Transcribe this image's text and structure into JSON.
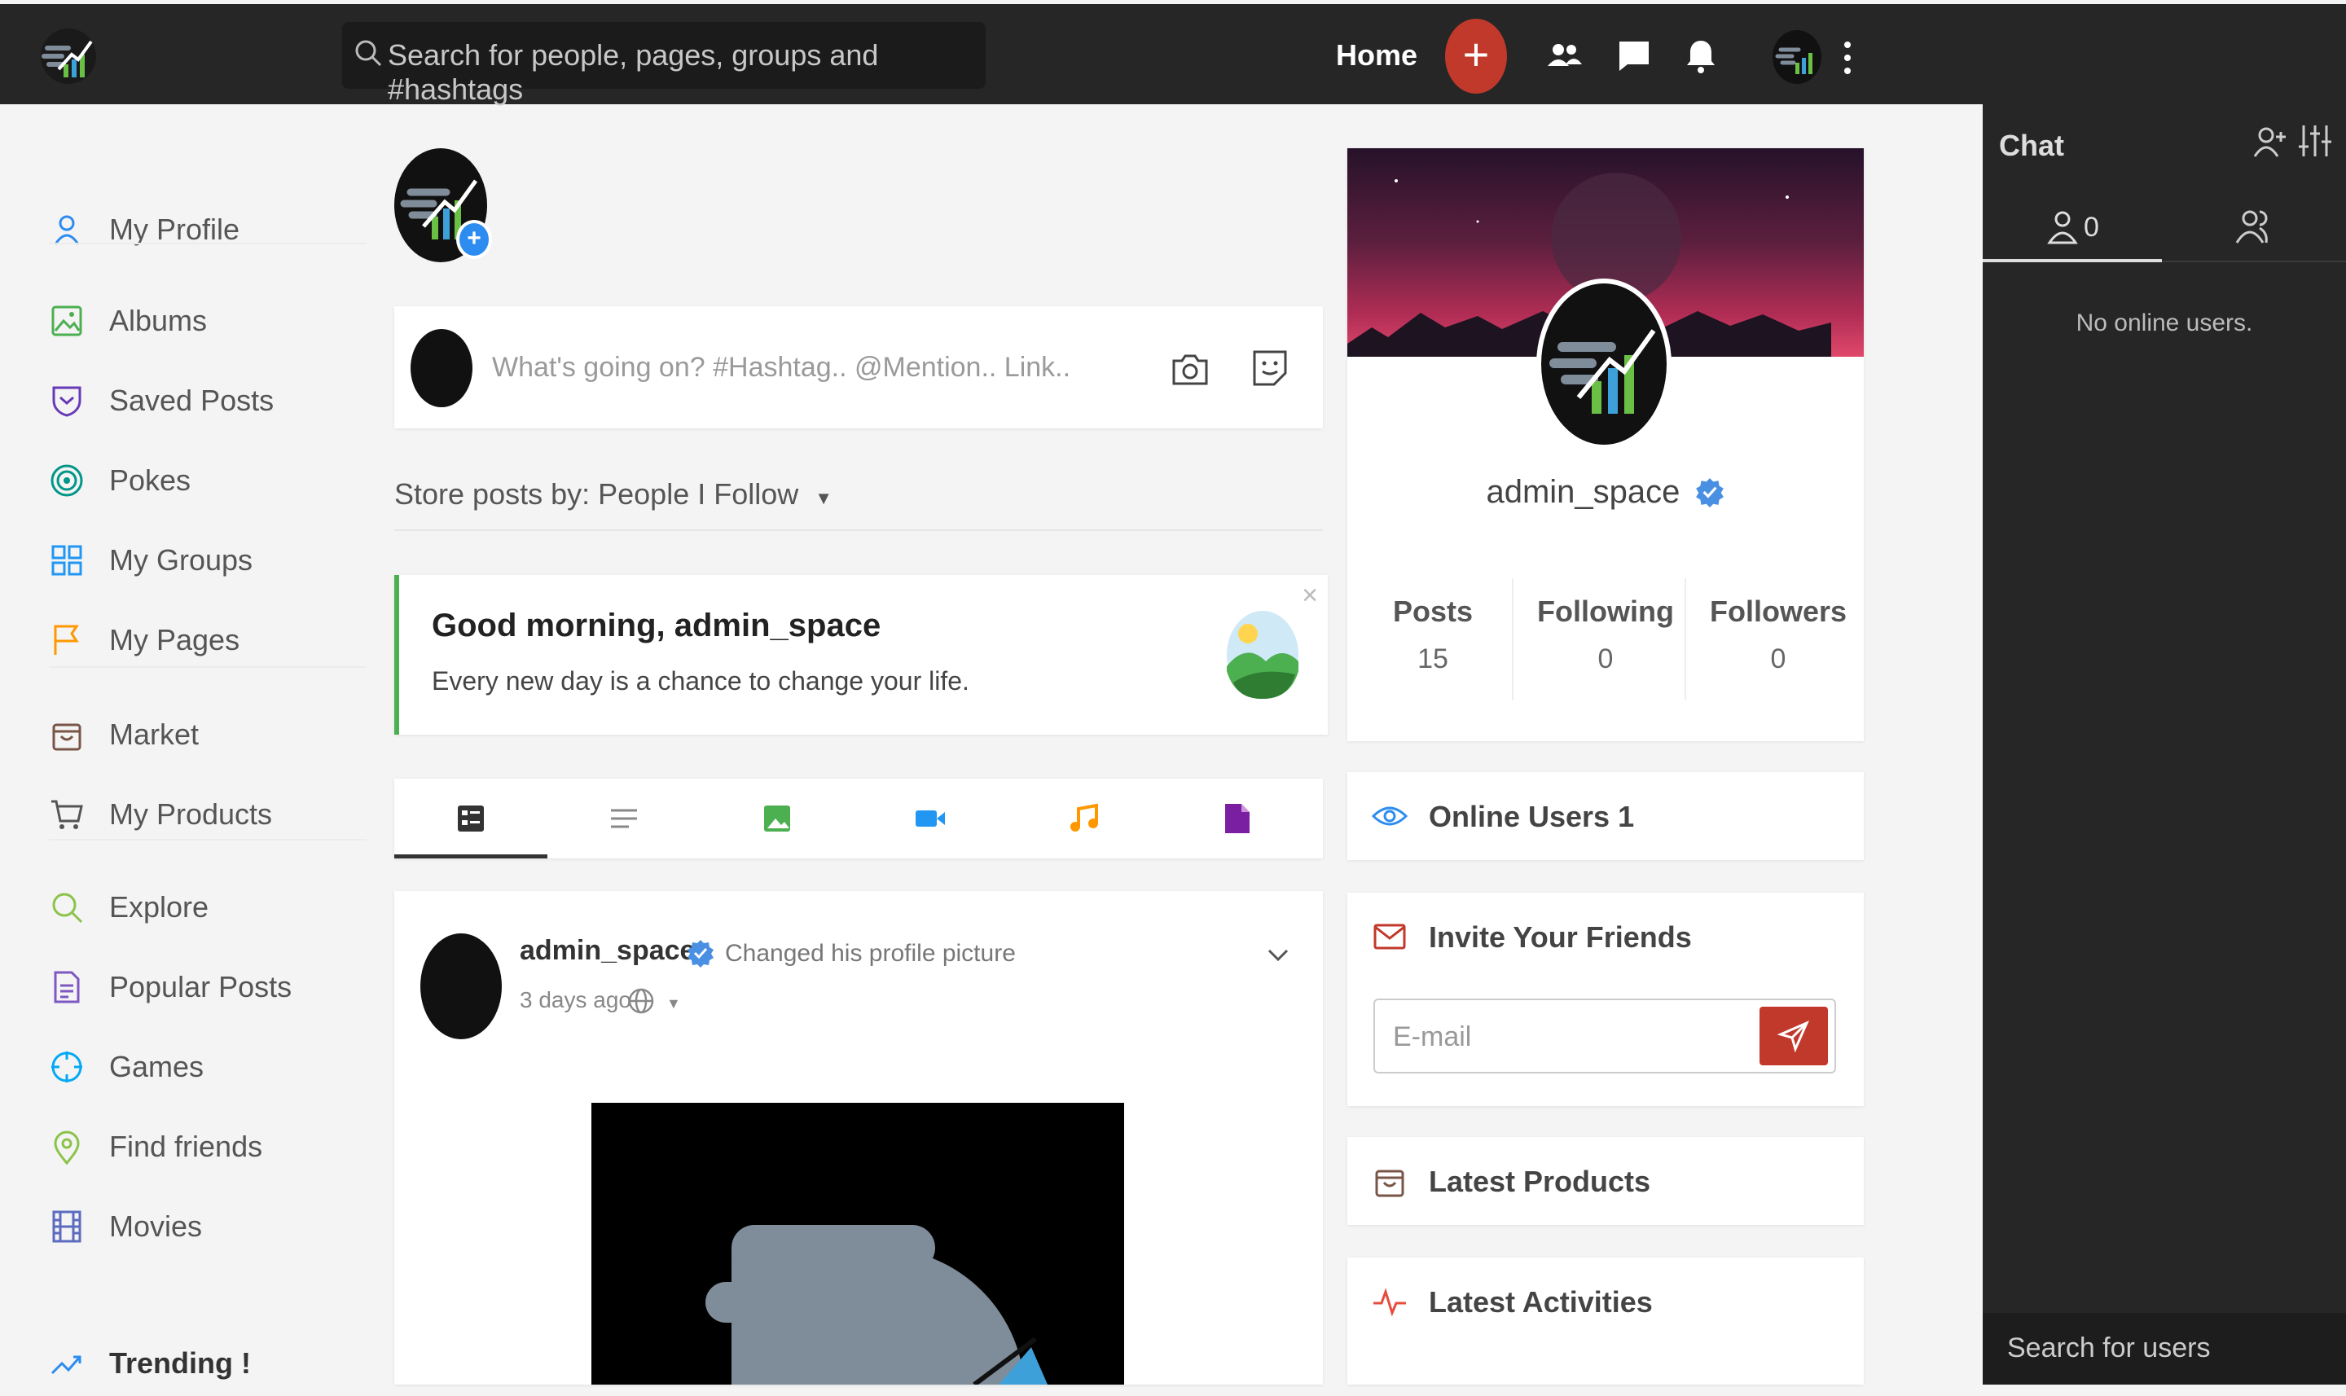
{
  "header": {
    "search_placeholder": "Search for people, pages, groups and #hashtags",
    "home_label": "Home",
    "add_label": "+"
  },
  "sidebar": {
    "items": [
      {
        "label": "My Profile",
        "icon": "user-icon",
        "color": "#2d8cf0"
      },
      {
        "label": "Albums",
        "icon": "image-icon",
        "color": "#4caf50"
      },
      {
        "label": "Saved Posts",
        "icon": "bookmark-shield-icon",
        "color": "#673ab7"
      },
      {
        "label": "Pokes",
        "icon": "target-icon",
        "color": "#009688"
      },
      {
        "label": "My Groups",
        "icon": "grid-icon",
        "color": "#2196f3"
      },
      {
        "label": "My Pages",
        "icon": "flag-icon",
        "color": "#ff9800"
      },
      {
        "label": "Market",
        "icon": "shopping-bag-icon",
        "color": "#795548"
      },
      {
        "label": "My Products",
        "icon": "cart-icon",
        "color": "#555555"
      },
      {
        "label": "Explore",
        "icon": "search-icon",
        "color": "#8bc34a"
      },
      {
        "label": "Popular Posts",
        "icon": "document-icon",
        "color": "#7e57c2"
      },
      {
        "label": "Games",
        "icon": "crosshair-icon",
        "color": "#03a9f4"
      },
      {
        "label": "Find friends",
        "icon": "map-pin-icon",
        "color": "#8bc34a"
      },
      {
        "label": "Movies",
        "icon": "film-icon",
        "color": "#5c6bc0"
      }
    ],
    "trending_label": "Trending !"
  },
  "publisher": {
    "placeholder": "What's going on? #Hashtag.. @Mention.. Link.."
  },
  "feed": {
    "filter_label": "Store posts by: People I Follow",
    "greeting": {
      "title": "Good morning, admin_space",
      "text": "Every new day is a chance to change your life.",
      "close": "×"
    },
    "tabs": [
      {
        "icon": "all-posts-icon",
        "color": "#333333"
      },
      {
        "icon": "text-icon",
        "color": "#888888"
      },
      {
        "icon": "photo-icon",
        "color": "#4caf50"
      },
      {
        "icon": "video-icon",
        "color": "#2196f3"
      },
      {
        "icon": "music-icon",
        "color": "#ff9800"
      },
      {
        "icon": "file-icon",
        "color": "#7b1fa2"
      }
    ],
    "post": {
      "author": "admin_space",
      "action": "Changed his profile picture",
      "time": "3 days ago"
    }
  },
  "profile": {
    "name": "admin_space",
    "stats": [
      {
        "label": "Posts",
        "value": "15"
      },
      {
        "label": "Following",
        "value": "0"
      },
      {
        "label": "Followers",
        "value": "0"
      }
    ]
  },
  "widgets": {
    "online_users": "Online Users 1",
    "invite_title": "Invite Your Friends",
    "email_placeholder": "E-mail",
    "latest_products": "Latest Products",
    "latest_activities": "Latest Activities"
  },
  "chat": {
    "title": "Chat",
    "online_count": "0",
    "no_online": "No online users.",
    "search_placeholder": "Search for users"
  },
  "colors": {
    "accent_red": "#c0392b",
    "verified_blue": "#4a90e2",
    "greeting_border": "#4caf50",
    "topbar_bg": "#262626"
  }
}
